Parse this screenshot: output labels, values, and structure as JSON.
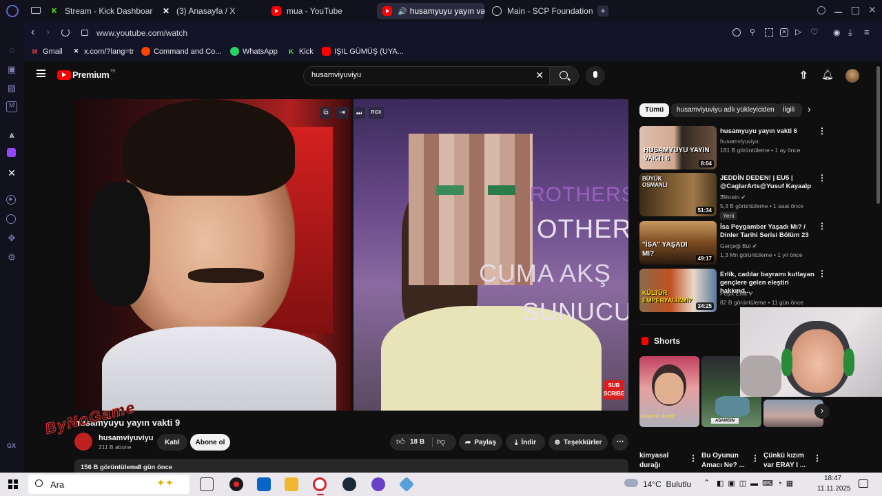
{
  "browser": {
    "tabs": [
      {
        "label": "Stream - Kick Dashboard",
        "icon": "kick-icon"
      },
      {
        "label": "(3) Anasayfa / X",
        "icon": "x-icon"
      },
      {
        "label": "mua - YouTube",
        "icon": "youtube-icon"
      },
      {
        "label": "husamyuyu yayın vakt",
        "icon": "youtube-icon",
        "active": true
      },
      {
        "label": "Main - SCP Foundation",
        "icon": "scp-icon"
      }
    ],
    "url": "www.youtube.com/watch",
    "bookmarks": [
      {
        "label": "Gmail",
        "icon": "gmail-icon"
      },
      {
        "label": "x.com/?lang=tr",
        "icon": "x-icon"
      },
      {
        "label": "Command and Co...",
        "icon": "reddit-icon"
      },
      {
        "label": "WhatsApp",
        "icon": "whatsapp-icon"
      },
      {
        "label": "Kick",
        "icon": "kick-icon"
      },
      {
        "label": "IŞIL GÜMÜŞ (UYA...",
        "icon": "youtube-icon"
      }
    ],
    "sidebar_labels": {
      "gx": "GX"
    }
  },
  "youtube": {
    "logo": "Premium",
    "logo_sup": "TR",
    "search_value": "husamviyuviyu",
    "video": {
      "title": "husamyuyu yayın vakti 9",
      "overlay_text_1": "ROTHERS C",
      "overlay_text_2": "OTHER",
      "overlay_text_3": "CUMA AKŞ",
      "overlay_text_4": "SUNUCU",
      "subscribe_badge_1": "SUB",
      "subscribe_badge_2": "SCRIBE",
      "watermark": "ByNoGame",
      "top_badge": "RGX"
    },
    "channel": {
      "name": "husamviyuviyu",
      "subs": "211 B abone",
      "join": "Katıl",
      "subscribe": "Abone ol"
    },
    "actions": {
      "likes": "18 B",
      "share": "Paylaş",
      "download": "İndir",
      "thanks": "Teşekkürler"
    },
    "description": {
      "views": "156 B görüntüleme",
      "date": "3 gün önce"
    },
    "chips": [
      "Tümü",
      "husamviyuviyu adlı yükleyiciden",
      "İlgili"
    ],
    "recommendations": [
      {
        "title": "husamyuyu yayın vakti 6",
        "channel": "husamviyuviyu",
        "meta": "181 B görüntüleme • 1 ay önce",
        "duration": "8:04",
        "thumb_text": "HUSAMYUYU YAYIN VAKTI 6",
        "verified": false
      },
      {
        "title": "JEDDİN DEDEN! | EU5 | @CaglarArts@Yusuf Kayaalp ...",
        "channel": "Jahrein",
        "meta": "5,3 B görüntüleme • 1 saat önce",
        "duration": "51:34",
        "thumb_text": "BÜYÜK OSMANLI",
        "badge": "Yeni",
        "verified": true
      },
      {
        "title": "İsa Peygamber Yaşadı Mı? / Dinler Tarihi Serisi Bölüm 23",
        "channel": "Gerçeği Bul",
        "meta": "1,3 Mn görüntüleme • 1 yıl önce",
        "duration": "49:17",
        "thumb_text": "\"İSA\" YAŞADI MI?",
        "verified": true
      },
      {
        "title": "Erlik, cadılar bayramı kutlayan gençlere gelen eleştiri hakkınd...",
        "channel": "Foşix Erlik",
        "meta": "82 B görüntüleme • 11 gün önce",
        "duration": "34:25",
        "thumb_text": "KÜLTÜR EMPERYALİZMİ?",
        "verified": true
      }
    ],
    "shorts": {
      "heading": "Shorts",
      "items": [
        {
          "title_line1": "kimyasal",
          "title_line2": "durağı",
          "overlay": "kimyasal durağı"
        },
        {
          "title_line1": "Bu Oyunun",
          "title_line2": "Amacı Ne? ...",
          "overlay": "ADAMSIN"
        },
        {
          "title_line1": "Çünkü kızım",
          "title_line2": "var ERAY I ..."
        }
      ]
    }
  },
  "taskbar": {
    "search_placeholder": "Ara",
    "weather": "14°C  Bulutlu",
    "time": "18:47",
    "date": "11.11.2025"
  }
}
